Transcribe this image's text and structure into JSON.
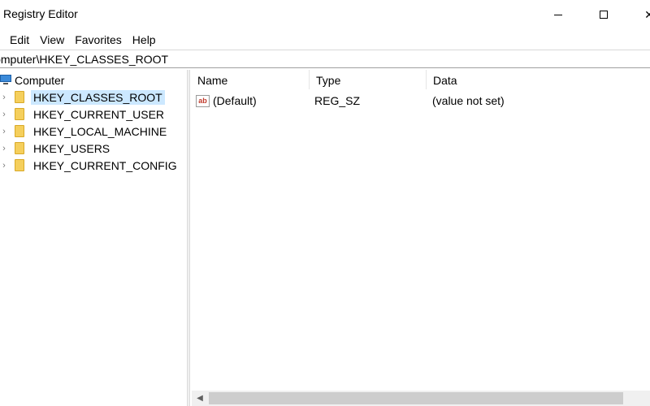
{
  "window": {
    "title": "Registry Editor",
    "close_glyph": "✕"
  },
  "menu": [
    "Edit",
    "View",
    "Favorites",
    "Help"
  ],
  "address": {
    "path": "Computer\\HKEY_CLASSES_ROOT"
  },
  "tree": {
    "root": "Computer",
    "expander_glyph": "›",
    "items": [
      {
        "label": "HKEY_CLASSES_ROOT",
        "selected": true
      },
      {
        "label": "HKEY_CURRENT_USER",
        "selected": false
      },
      {
        "label": "HKEY_LOCAL_MACHINE",
        "selected": false
      },
      {
        "label": "HKEY_USERS",
        "selected": false
      },
      {
        "label": "HKEY_CURRENT_CONFIG",
        "selected": false
      }
    ]
  },
  "list": {
    "columns": [
      "Name",
      "Type",
      "Data"
    ],
    "rows": [
      {
        "name": "(Default)",
        "type": "REG_SZ",
        "data": "(value not set)",
        "icon": "string-value-icon",
        "icon_text": "ab"
      }
    ]
  },
  "scrollbar": {
    "left_arrow": "◀"
  },
  "colors": {
    "selection": "#cce8ff",
    "folder": "#f5cf5c"
  }
}
